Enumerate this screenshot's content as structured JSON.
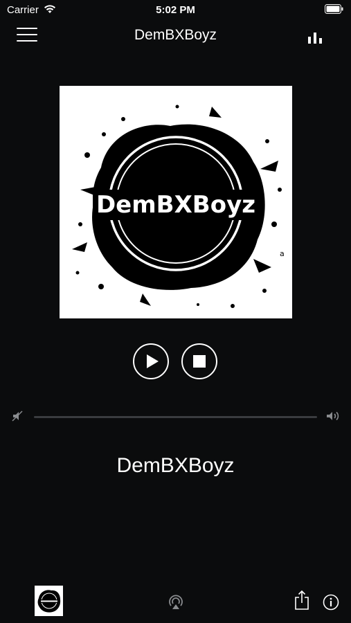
{
  "status_bar": {
    "carrier": "Carrier",
    "time": "5:02 PM",
    "icons": [
      "wifi-icon",
      "battery-icon"
    ]
  },
  "nav": {
    "title": "DemBXBoyz",
    "left_icon": "hamburger-menu-icon",
    "right_icon": "equalizer-icon"
  },
  "artwork": {
    "logo_text": "DemBXBoyz",
    "corner_mark": "a"
  },
  "player": {
    "play_icon": "play-icon",
    "stop_icon": "stop-icon",
    "volume_min_icon": "volume-mute-icon",
    "volume_max_icon": "volume-max-icon"
  },
  "station": {
    "name": "DemBXBoyz"
  },
  "toolbar": {
    "icons": [
      "station-thumbnail",
      "airplay-icon",
      "share-icon",
      "info-icon"
    ]
  },
  "colors": {
    "background": "#0b0c0d",
    "foreground": "#ffffff",
    "track": "#3a3c3f"
  }
}
